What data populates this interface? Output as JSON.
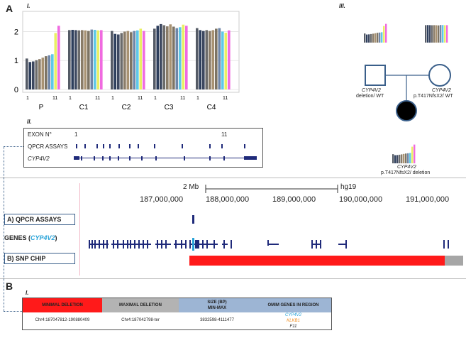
{
  "panel_a": {
    "letter": "A",
    "sub_i": "I.",
    "sub_ii": "II.",
    "sub_iii": "III."
  },
  "panel_b": {
    "letter": "B",
    "sub_i": "I."
  },
  "chart_data": {
    "type": "bar",
    "groups": [
      "P",
      "C1",
      "C2",
      "C3",
      "C4"
    ],
    "tick_first": "1",
    "tick_last": "11",
    "y_ticks": [
      "0",
      "1",
      "2"
    ],
    "ylim": [
      0,
      2.6
    ],
    "series_colors": [
      "#555b66",
      "#2d3e5c",
      "#3d4860",
      "#6b6b6b",
      "#8a7c68",
      "#a89272",
      "#7d7464",
      "#6f86a8",
      "#5ec8e8",
      "#e9ef63",
      "#f06ae0"
    ],
    "values": [
      [
        1.07,
        0.95,
        0.97,
        1.01,
        1.05,
        1.1,
        1.15,
        1.18,
        1.22,
        1.95,
        2.2
      ],
      [
        2.05,
        2.06,
        2.05,
        2.04,
        2.05,
        2.04,
        2.02,
        2.07,
        2.06,
        2.04,
        2.05
      ],
      [
        2.02,
        1.92,
        1.9,
        1.95,
        2.0,
        2.02,
        1.98,
        2.02,
        2.04,
        2.1,
        2.02
      ],
      [
        2.1,
        2.2,
        2.26,
        2.22,
        2.18,
        2.25,
        2.17,
        2.12,
        2.15,
        2.24,
        2.2
      ],
      [
        2.12,
        2.05,
        2.02,
        2.05,
        2.02,
        2.05,
        2.1,
        2.12,
        2.0,
        1.96,
        2.04
      ]
    ]
  },
  "gene_panel": {
    "exon_label": "EXON N°",
    "exon_first": "1",
    "exon_last": "11",
    "qpcr_label": "QPCR ASSAYS",
    "gene_label": "CYP4V2"
  },
  "pedigree": {
    "father_gene": "CYP4V2",
    "father_geno": "deletion/ WT",
    "mother_gene": "CYP4V2",
    "mother_geno": "p.T417NfsX2/ WT",
    "child_gene": "CYP4V2",
    "child_geno": "p.T417NfsX2/ deletion"
  },
  "genome": {
    "scale": "2 Mb",
    "assembly": "hg19",
    "ticks": [
      "187,000,000",
      "188,000,000",
      "189,000,000",
      "190,000,000",
      "191,000,000"
    ],
    "track_qpcr": "A) QPCR ASSAYS",
    "track_genes_prefix": "GENES (",
    "track_genes_gene": "CYP4V2",
    "track_genes_suffix": ")",
    "track_snp": "B) SNP CHIP",
    "colors": {
      "gene": "#1f2a7a",
      "snp_red": "#ff1a1a",
      "snp_gray": "#a6a6a6",
      "cyp_label": "#29a3d8"
    }
  },
  "table": {
    "headers": [
      "MINIMAL DELETION",
      "MAXIMAL DELETION",
      "SIZE (BP)",
      "MIN-MAX",
      "OMIM GENES IN REGION"
    ],
    "min_del": "Chr4:187047812-190880409",
    "max_del": "Chr4:187042798-ter",
    "size": "3832598-4111477",
    "genes": [
      "CYP4V2",
      "KLKB1",
      "F11"
    ],
    "colors": {
      "min": "#ff1a1a",
      "max": "#b3b3b3",
      "size": "#9db5d4",
      "omim": "#9db5d4",
      "g1": "#29a3d8",
      "g2": "#f08c1c",
      "g3": "#222222"
    }
  }
}
